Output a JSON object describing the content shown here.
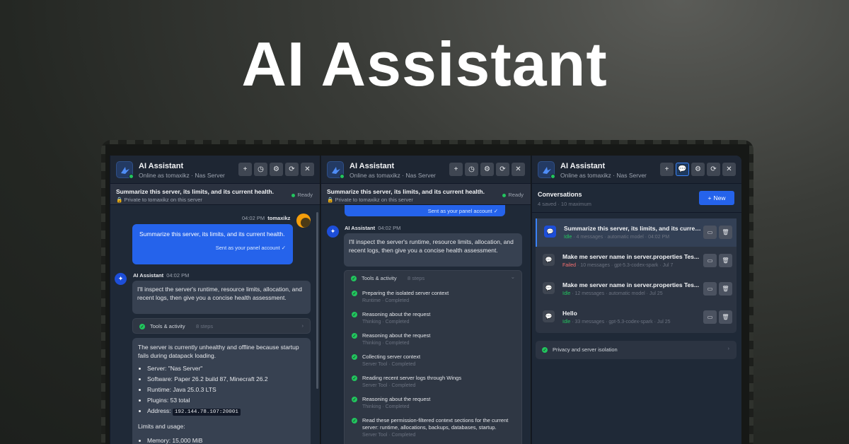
{
  "hero": {
    "title": "AI Assistant"
  },
  "header": {
    "title": "AI Assistant",
    "subtitle": "Online as tomaxikz · Nas Server"
  },
  "toolbar": {
    "new": "+",
    "history": "◷",
    "settings": "⚙",
    "refresh": "⟳",
    "close": "✕"
  },
  "chat": {
    "heading": "Summarize this server, its limits, and its current health.",
    "private_note": "Private to tomaxikz on this server",
    "status": "Ready",
    "user_time": "04:02 PM",
    "user_name": "tomaxikz",
    "user_message": "Summarize this server, its limits, and its current health.",
    "sent_as": "Sent as your panel account",
    "ai_name": "AI Assistant",
    "ai_time": "04:02 PM",
    "ai_intro": "I'll inspect the server's runtime, resource limits, allocation, and recent logs, then give you a concise health assessment.",
    "tools_label": "Tools & activity",
    "tools_steps": "8 steps",
    "summary_intro": "The server is currently unhealthy and offline because startup fails during datapack loading.",
    "facts": [
      {
        "label": "Server: \"Nas Server\""
      },
      {
        "label": "Software: Paper 26.2 build 87, Minecraft 26.2"
      },
      {
        "label": "Runtime: Java 25.0.3 LTS"
      },
      {
        "label": "Plugins: 53 total"
      }
    ],
    "address_label": "Address:",
    "address_value": "192.144.78.107:20001",
    "limits_label": "Limits and usage:",
    "memory": "Memory: 15,000 MiB"
  },
  "activity": {
    "sent_as": "Sent as your panel account",
    "steps": [
      {
        "title": "Preparing the isolated server context",
        "kind": "Runtime · Completed"
      },
      {
        "title": "Reasoning about the request",
        "kind": "Thinking · Completed"
      },
      {
        "title": "Reasoning about the request",
        "kind": "Thinking · Completed"
      },
      {
        "title": "Collecting server context",
        "kind": "Server Tool · Completed"
      },
      {
        "title": "Reading recent server logs through Wings",
        "kind": "Server Tool · Completed"
      },
      {
        "title": "Reasoning about the request",
        "kind": "Thinking · Completed"
      },
      {
        "title": "Read these permission-filtered context sections for the current server: runtime, allocations, backups, databases, startup.",
        "kind": "Server Tool · Completed"
      }
    ]
  },
  "conversations": {
    "title": "Conversations",
    "subtitle": "4 saved · 10 maximum",
    "new_label": "New",
    "items": [
      {
        "title": "Summarize this server, its limits, and its curren...",
        "status": "Idle",
        "meta": "· 4 messages · automatic model · 04:02 PM"
      },
      {
        "title": "Make me server name in server.properties Tes...",
        "status": "Failed",
        "meta": "· 10 messages · gpt-5.3-codex-spark · Jul 7"
      },
      {
        "title": "Make me server name in server.properties Tes...",
        "status": "Idle",
        "meta": "· 12 messages · automatic model · Jul 25"
      },
      {
        "title": "Hello",
        "status": "Idle",
        "meta": "· 33 messages · gpt-5.3-codex-spark · Jul 25"
      }
    ],
    "privacy_label": "Privacy and server isolation"
  },
  "colors": {
    "accent": "#2563eb",
    "ok": "#22c55e",
    "fail": "#f87171",
    "panel": "#1f2937"
  }
}
